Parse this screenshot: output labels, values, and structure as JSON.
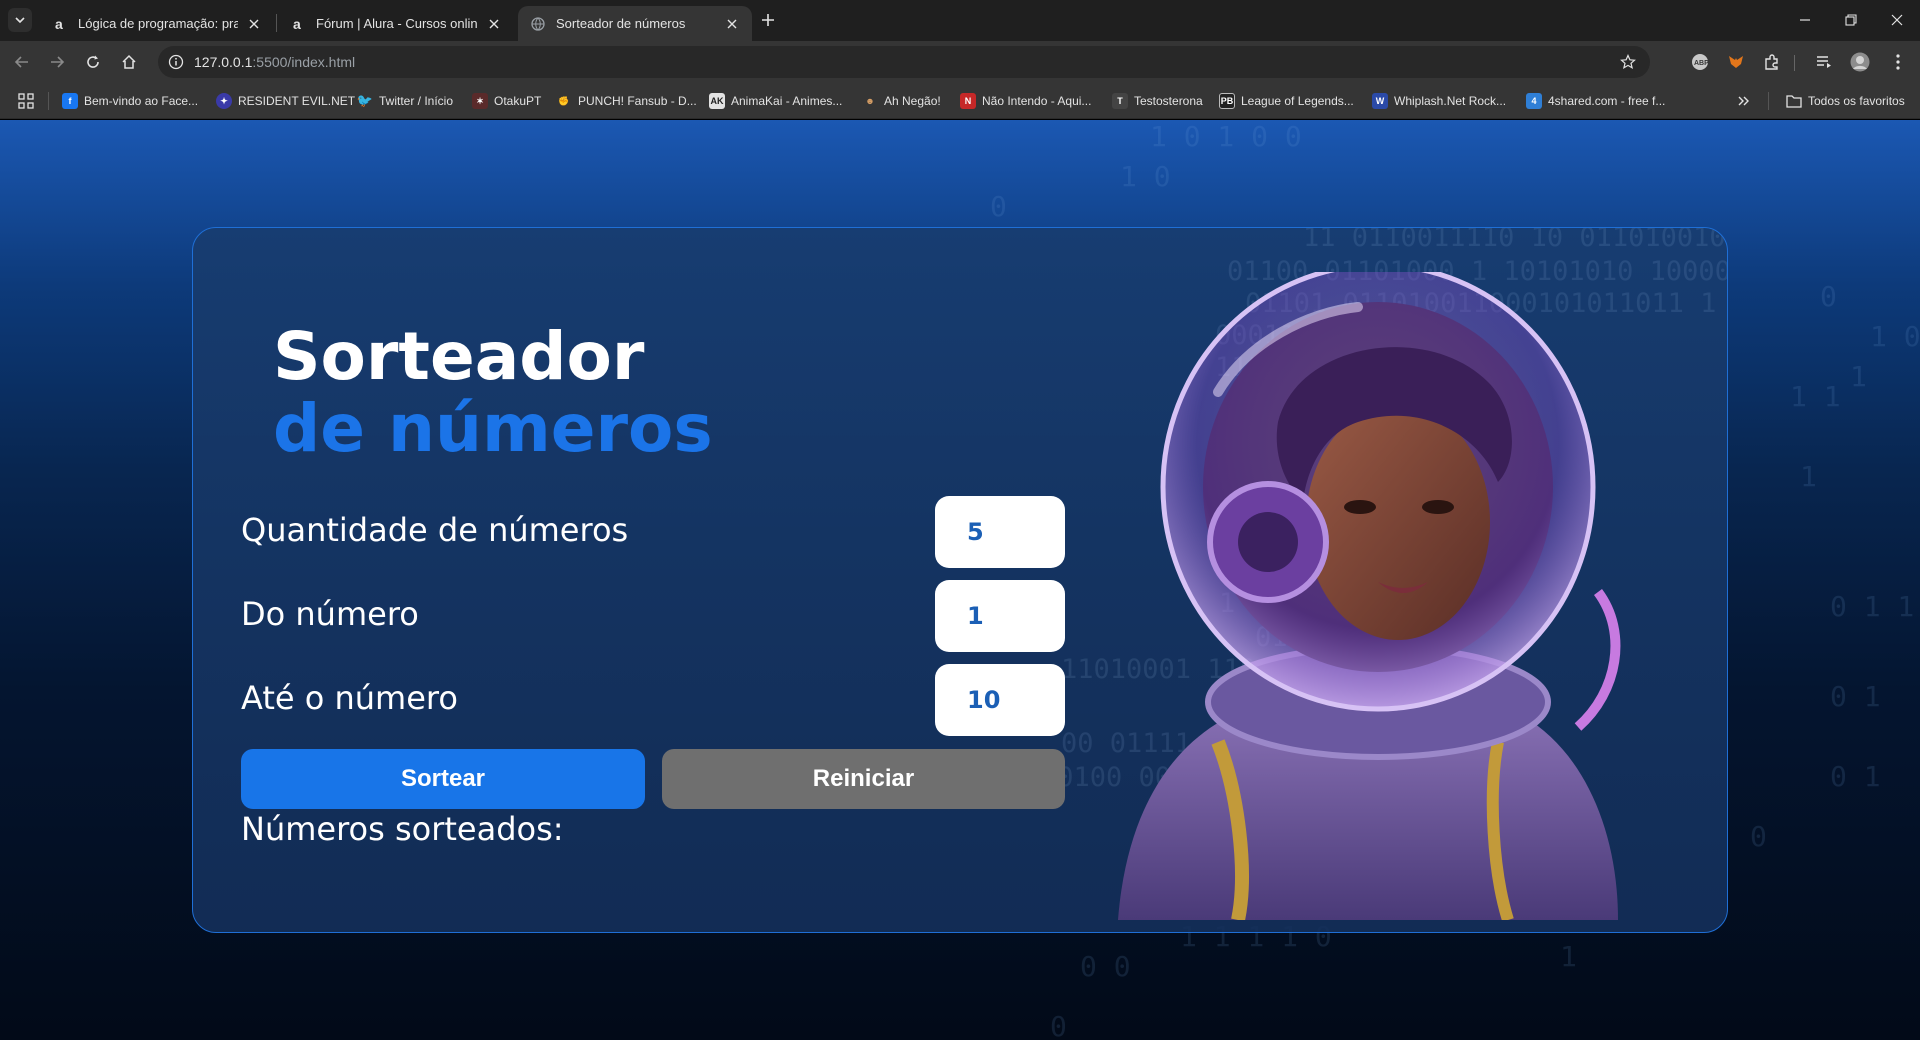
{
  "tabs": [
    {
      "title": "Lógica de programação: pratica",
      "active": false
    },
    {
      "title": "Fórum | Alura - Cursos online d",
      "active": false
    },
    {
      "title": "Sorteador de números",
      "active": true
    }
  ],
  "address": {
    "host": "127.0.0.1",
    "path": ":5500/index.html"
  },
  "bookmarks": [
    "Bem-vindo ao Face...",
    "RESIDENT EVIL.NET",
    "Twitter / Início",
    "OtakuPT",
    "PUNCH! Fansub - D...",
    "AnimaKai - Animes...",
    "Ah Negão!",
    "Não Intendo - Aqui...",
    "Testosterona",
    "League of Legends...",
    "Whiplash.Net Rock...",
    "4shared.com - free f..."
  ],
  "bookmarks_folder": "Todos os favoritos",
  "page": {
    "title_line1": "Sorteador",
    "title_line2": "de números",
    "fields": [
      {
        "label": "Quantidade de números",
        "value": "5"
      },
      {
        "label": "Do número",
        "value": "1"
      },
      {
        "label": "Até o número",
        "value": "10"
      }
    ],
    "draw_button": "Sortear",
    "reset_button": "Reiniciar",
    "result_label": "Números sorteados:"
  },
  "colors": {
    "accent": "#1875e8",
    "title_accent": "#1b74e8",
    "reset": "#6f6f6f",
    "card_border": "#1f6fd6"
  }
}
